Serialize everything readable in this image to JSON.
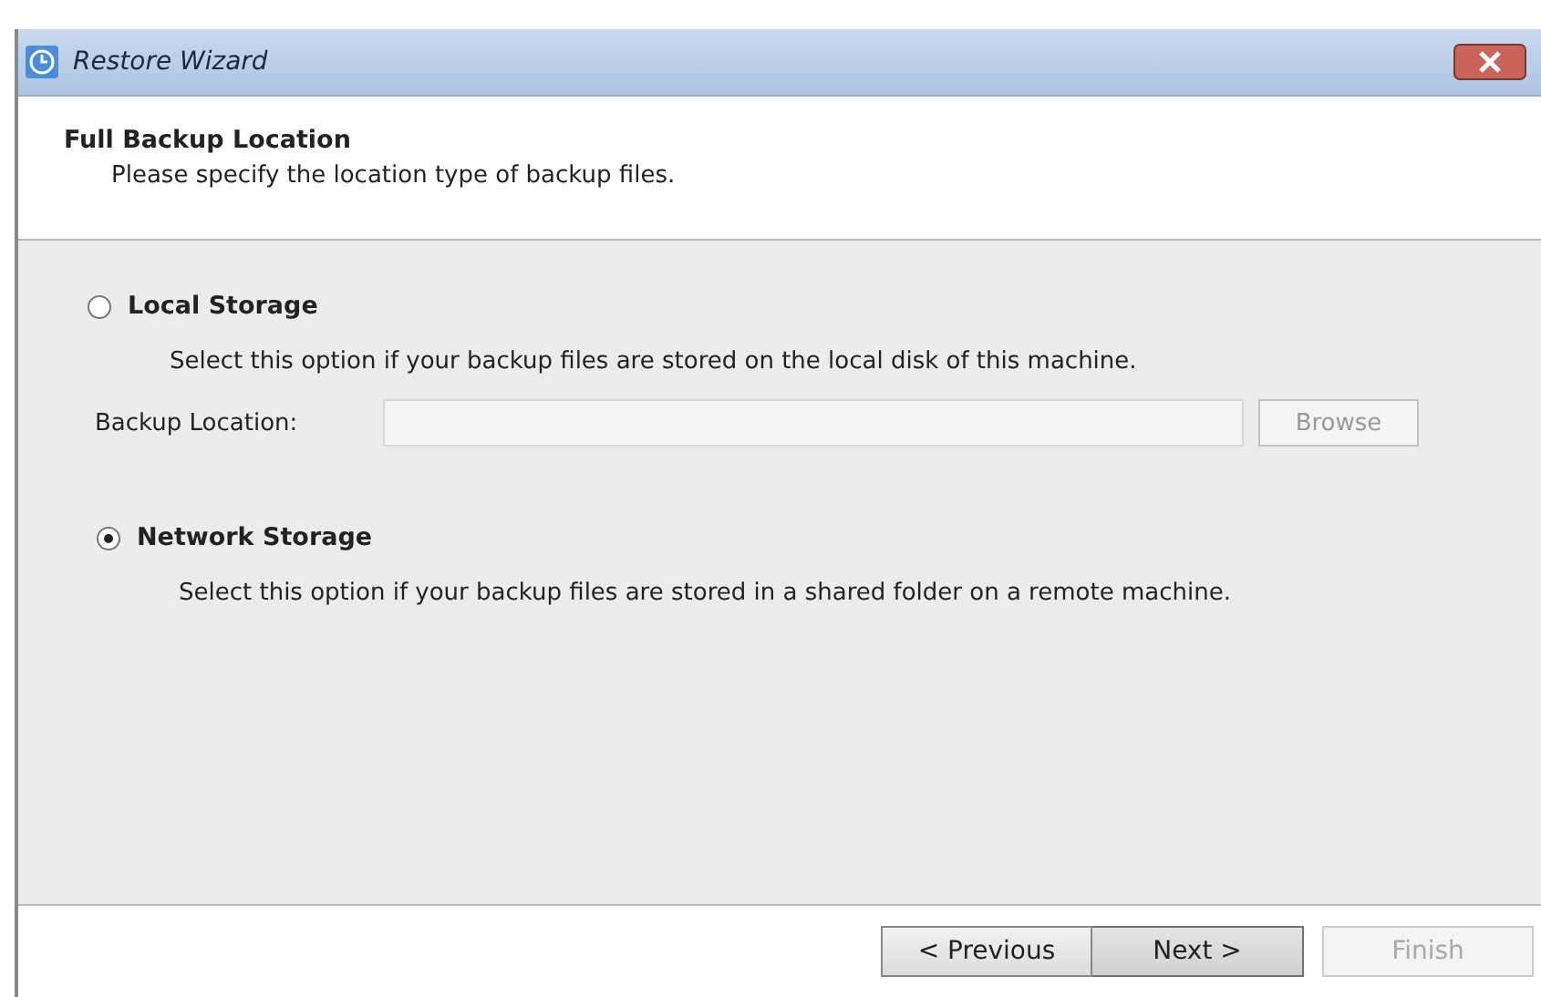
{
  "window": {
    "title": "Restore Wizard"
  },
  "header": {
    "title": "Full Backup Location",
    "subtitle": "Please specify the location type of backup files."
  },
  "options": [
    {
      "label": "Local Storage",
      "selected": false,
      "description": "Select this option if your backup files are stored on the local disk of this machine.",
      "location": {
        "label": "Backup Location:",
        "button": {
          "label": "Browse",
          "disabled": true
        }
      }
    },
    {
      "label": "Network Storage",
      "selected": true,
      "description": "Select this option if your backup files are stored in a shared folder on a remote machine."
    }
  ],
  "buttons": [
    {
      "label": "< Previous",
      "disabled": false,
      "focused": false
    },
    {
      "label": "Next >",
      "disabled": false,
      "focused": true
    },
    {
      "label": "Finish",
      "disabled": true,
      "focused": false
    }
  ]
}
